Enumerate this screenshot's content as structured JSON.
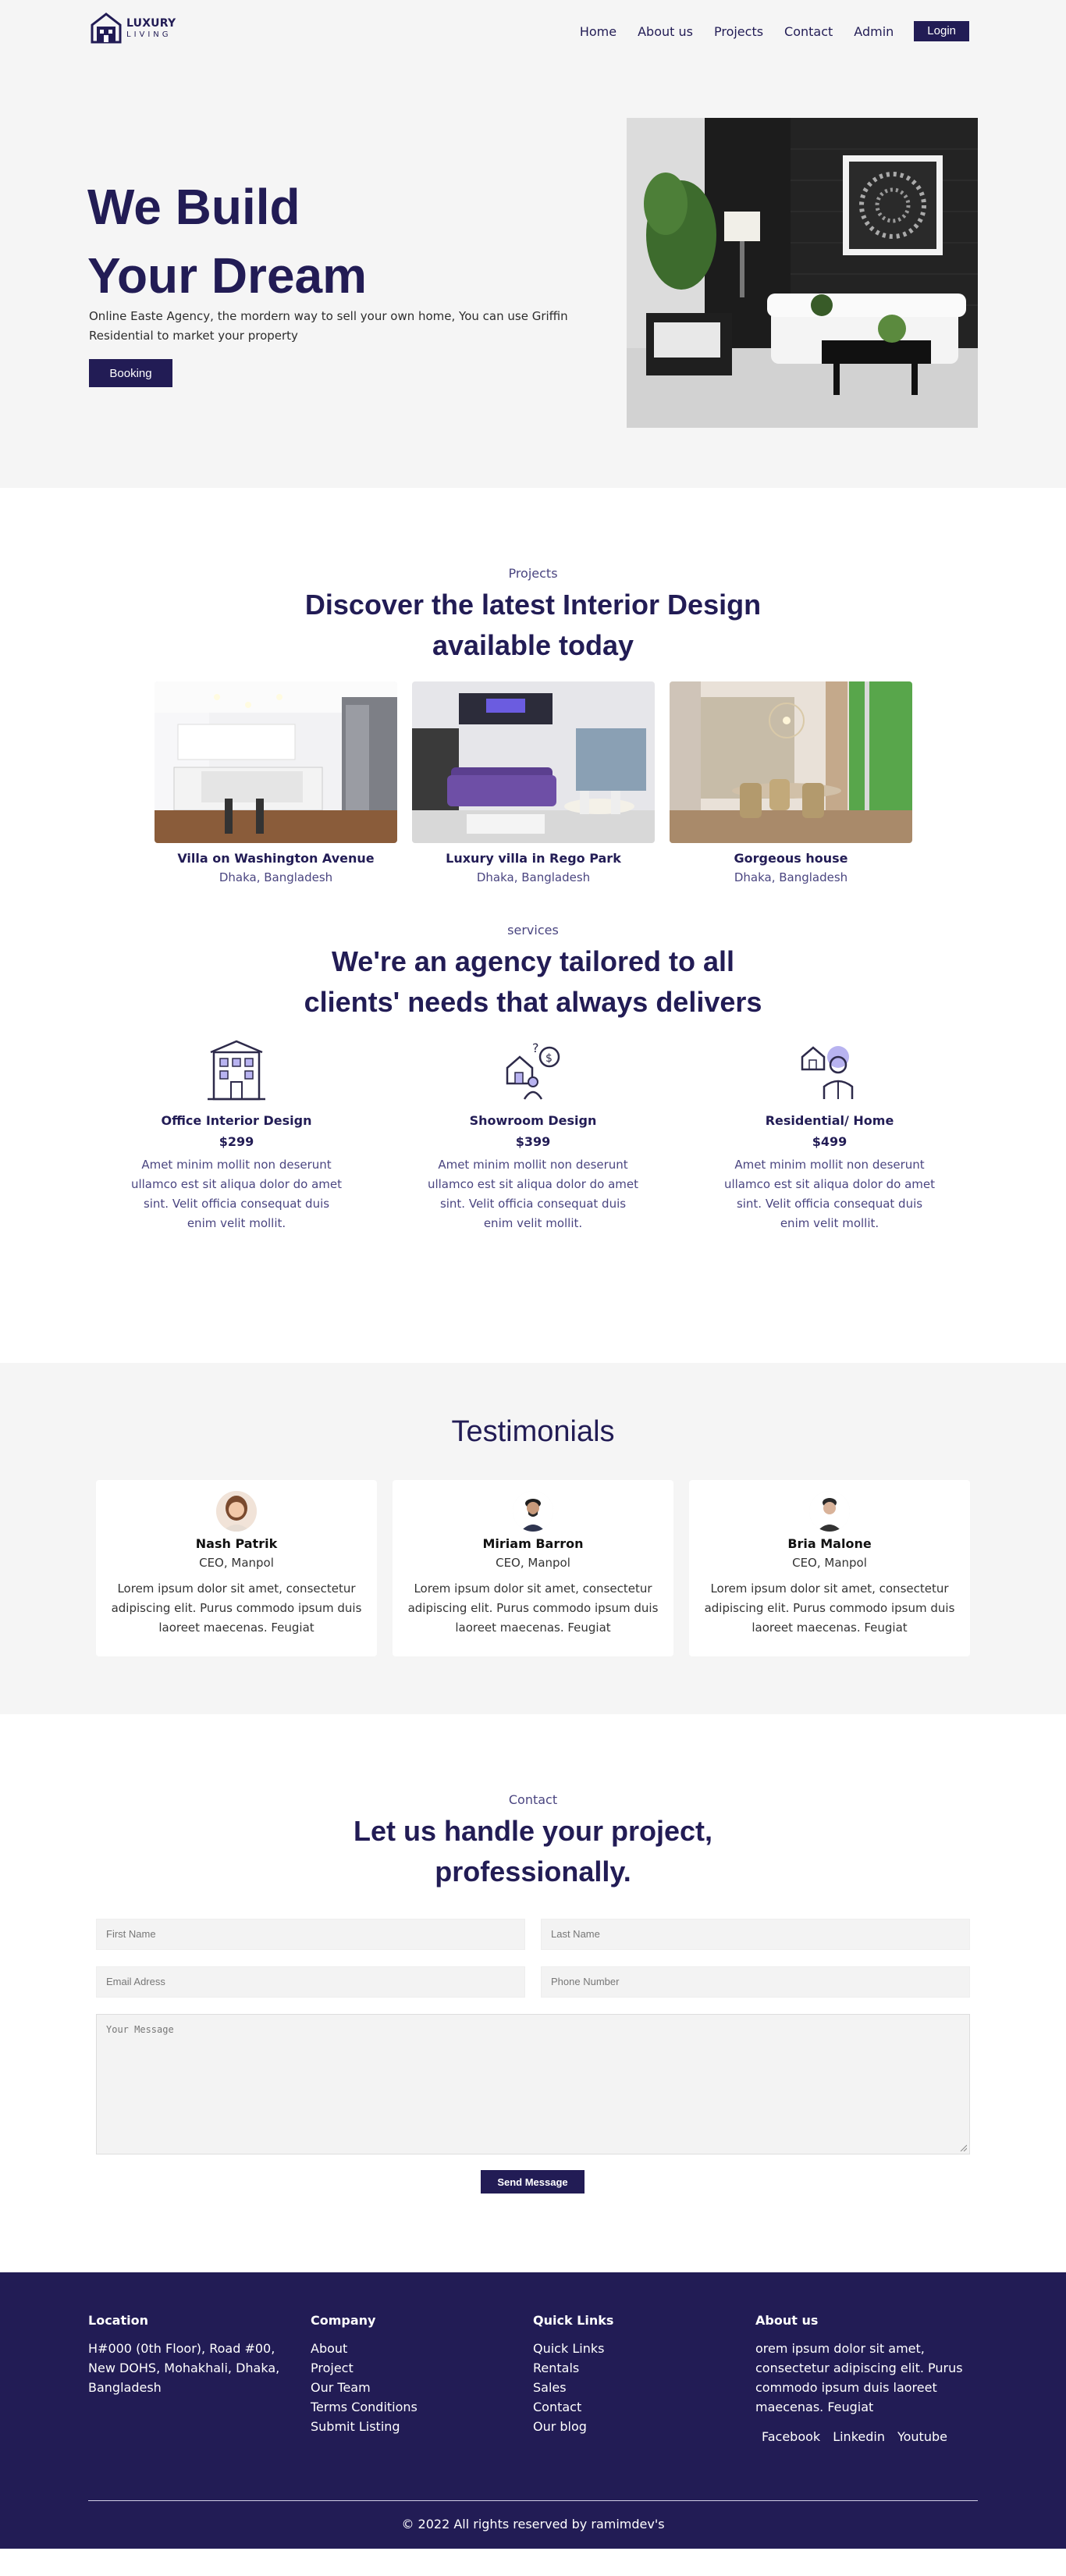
{
  "nav": {
    "logo_line1": "LUXURY",
    "logo_line2": "LIVING",
    "links": [
      "Home",
      "About us",
      "Projects",
      "Contact",
      "Admin"
    ],
    "login_label": "Login"
  },
  "hero": {
    "title_line1": "We Build",
    "title_line2": "Your Dream",
    "description": "Online Easte Agency, the mordern way to sell your own home, You can use Griffin Residential to market your property",
    "booking_label": "Booking"
  },
  "projects": {
    "label": "Projects",
    "title": "Discover the latest Interior Design available today",
    "items": [
      {
        "name": "Villa on Washington Avenue",
        "location": "Dhaka, Bangladesh"
      },
      {
        "name": "Luxury villa in Rego Park",
        "location": "Dhaka, Bangladesh"
      },
      {
        "name": "Gorgeous house",
        "location": "Dhaka, Bangladesh"
      }
    ]
  },
  "services": {
    "label": "services",
    "title": "We're an agency tailored to all clients' needs that always delivers",
    "items": [
      {
        "name": "Office Interior Design",
        "price": "$299",
        "icon": "office-building-icon",
        "description": "Amet minim mollit non deserunt ullamco est sit aliqua dolor do amet sint. Velit officia consequat duis enim velit mollit."
      },
      {
        "name": "Showroom Design",
        "price": "$399",
        "icon": "showroom-icon",
        "description": "Amet minim mollit non deserunt ullamco est sit aliqua dolor do amet sint. Velit officia consequat duis enim velit mollit."
      },
      {
        "name": "Residential/ Home",
        "price": "$499",
        "icon": "residential-agent-icon",
        "description": "Amet minim mollit non deserunt ullamco est sit aliqua dolor do amet sint. Velit officia consequat duis enim velit mollit."
      }
    ]
  },
  "testimonials": {
    "title": "Testimonials",
    "items": [
      {
        "name": "Nash Patrik",
        "role": "CEO, Manpol",
        "text": "Lorem ipsum dolor sit amet, consectetur adipiscing elit. Purus commodo ipsum duis laoreet maecenas. Feugiat"
      },
      {
        "name": "Miriam Barron",
        "role": "CEO, Manpol",
        "text": "Lorem ipsum dolor sit amet, consectetur adipiscing elit. Purus commodo ipsum duis laoreet maecenas. Feugiat"
      },
      {
        "name": "Bria Malone",
        "role": "CEO, Manpol",
        "text": "Lorem ipsum dolor sit amet, consectetur adipiscing elit. Purus commodo ipsum duis laoreet maecenas. Feugiat"
      }
    ]
  },
  "contact": {
    "label": "Contact",
    "title": "Let us handle your project, professionally.",
    "first_name_placeholder": "First Name",
    "last_name_placeholder": "Last Name",
    "email_placeholder": "Email Adress",
    "phone_placeholder": "Phone Number",
    "message_placeholder": "Your Message",
    "send_label": "Send Message"
  },
  "footer": {
    "location_head": "Location",
    "location_text": "H#000 (0th Floor), Road #00, New DOHS, Mohakhali, Dhaka, Bangladesh",
    "company_head": "Company",
    "company_links": [
      "About",
      "Project",
      "Our Team",
      "Terms Conditions",
      "Submit Listing"
    ],
    "quick_head": "Quick Links",
    "quick_links": [
      "Quick Links",
      "Rentals",
      "Sales",
      "Contact",
      "Our blog"
    ],
    "about_head": "About us",
    "about_text": "orem ipsum dolor sit amet, consectetur adipiscing elit. Purus commodo ipsum duis laoreet maecenas. Feugiat",
    "socials": [
      "Facebook",
      "Linkedin",
      "Youtube"
    ],
    "copyright": "© 2022 All rights reserved by ramimdev's"
  },
  "colors": {
    "primary": "#221c55",
    "light_bg": "#f5f5f5",
    "accent_purple": "#b8b3f0"
  }
}
